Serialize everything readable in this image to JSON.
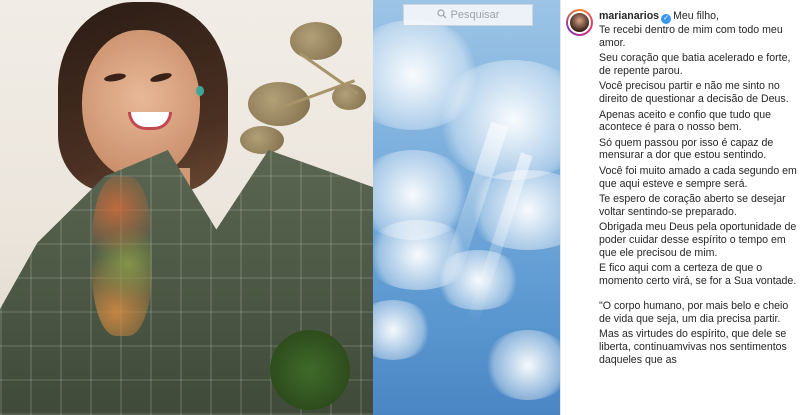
{
  "search": {
    "placeholder": "Pesquisar"
  },
  "post": {
    "username": "marianarios",
    "verified": true,
    "caption_lines": [
      "Meu filho,",
      "Te recebi dentro de mim com todo meu amor.",
      "Seu coração que batia acelerado e forte, de repente parou.",
      "Você precisou partir e não me sinto no direito de questionar a decisão de Deus.",
      "Apenas aceito e confio que tudo que acontece é para o nosso bem.",
      "Só quem passou por isso é capaz de mensurar a dor que estou sentindo.",
      "Você foi muito amado a cada segundo em que aqui esteve e sempre será.",
      "Te espero de coração aberto se desejar voltar sentindo-se preparado.",
      "Obrigada meu Deus pela oportunidade de poder cuidar desse espírito o tempo em que ele precisou de mim.",
      "E fico aqui com a certeza de que o momento certo virá, se for a Sua vontade.",
      "\"O corpo humano, por mais belo e cheio de vida que seja, um dia precisa partir.",
      "Mas as virtudes do espírito, que dele se liberta, continuamvivas nos sentimentos daqueles que as"
    ]
  },
  "colors": {
    "verified": "#3897f0",
    "text": "#262626"
  }
}
